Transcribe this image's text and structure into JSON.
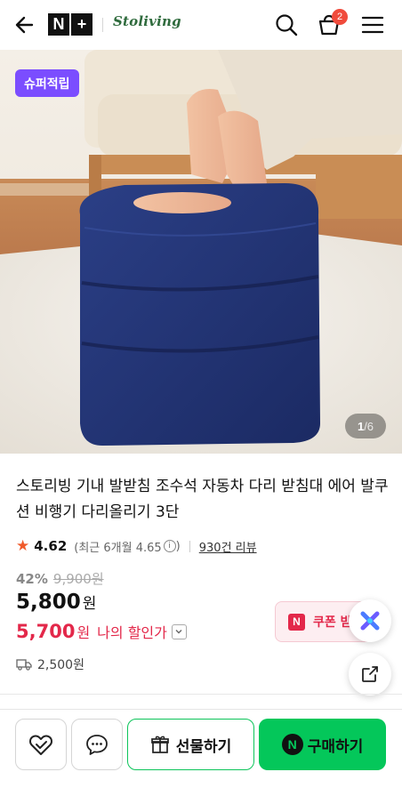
{
  "header": {
    "logo_letters": [
      "N",
      "+"
    ],
    "brand": "Stoliving",
    "cart_count": "2",
    "icons": [
      "back-arrow-icon",
      "search-icon",
      "cart-icon",
      "menu-icon"
    ]
  },
  "hero": {
    "badge": "슈퍼적립",
    "pager_current": "1",
    "pager_total": "/6"
  },
  "product": {
    "title": "스토리빙 기내 발받침 조수석 자동차 다리 받침대 에어 발쿠션 비행기 다리올리기 3단",
    "rating": "4.62",
    "recent_rating": "(최근 6개월 4.65",
    "recent_close": ")",
    "info_symbol": "i",
    "reviews": "930건 리뷰",
    "discount_pct": "42%",
    "original_price": "9,900원",
    "price": "5,800",
    "price_unit": "원",
    "my_price": "5,700",
    "my_price_unit": "원",
    "my_price_label": "나의 할인가",
    "coupon_label": "쿠폰 받",
    "coupon_logo": "N",
    "shipping": "2,500원"
  },
  "bottom_bar": {
    "gift_label": "선물하기",
    "buy_label": "구매하기",
    "buy_logo": "N"
  },
  "colors": {
    "accent_green": "#04c75a",
    "discount_red": "#e3284a",
    "badge_purple": "#7b4dff",
    "star_orange": "#f05a2a"
  }
}
